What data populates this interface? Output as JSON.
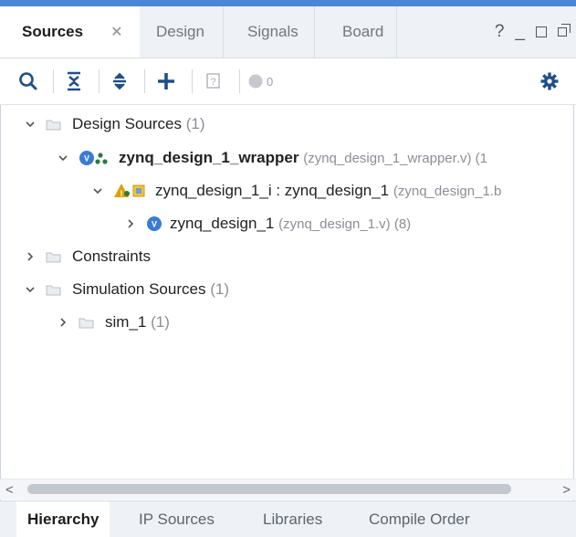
{
  "tabs": [
    {
      "label": "Sources",
      "active": true,
      "closable": true
    },
    {
      "label": "Design"
    },
    {
      "label": "Signals"
    },
    {
      "label": "Board"
    }
  ],
  "window_controls": {
    "help": "?",
    "minimize": "_"
  },
  "toolbar": {
    "items": [
      "search-icon",
      "collapse-all-icon",
      "expand-all-icon",
      "add-icon",
      "help-box-icon",
      "status-dot-icon",
      "gear-icon"
    ],
    "count": "0"
  },
  "tree": {
    "design_sources": {
      "label": "Design Sources",
      "count": "(1)"
    },
    "wrapper": {
      "label": "zynq_design_1_wrapper",
      "file": "(zynq_design_1_wrapper.v) (1"
    },
    "instance": {
      "label": "zynq_design_1_i : zynq_design_1",
      "file": "(zynq_design_1.b"
    },
    "design": {
      "label": "zynq_design_1",
      "file": "(zynq_design_1.v) (8)"
    },
    "constraints": {
      "label": "Constraints"
    },
    "simulation_sources": {
      "label": "Simulation Sources",
      "count": "(1)"
    },
    "sim_1": {
      "label": "sim_1",
      "count": "(1)"
    }
  },
  "scroll": {
    "left": "<",
    "right": ">"
  },
  "bottom_tabs": [
    {
      "label": "Hierarchy",
      "active": true
    },
    {
      "label": "IP Sources"
    },
    {
      "label": "Libraries"
    },
    {
      "label": "Compile Order"
    }
  ],
  "colors": {
    "accent": "#4a86d6",
    "warning": "#e0a000",
    "blue_icon": "#3a7bd5"
  }
}
